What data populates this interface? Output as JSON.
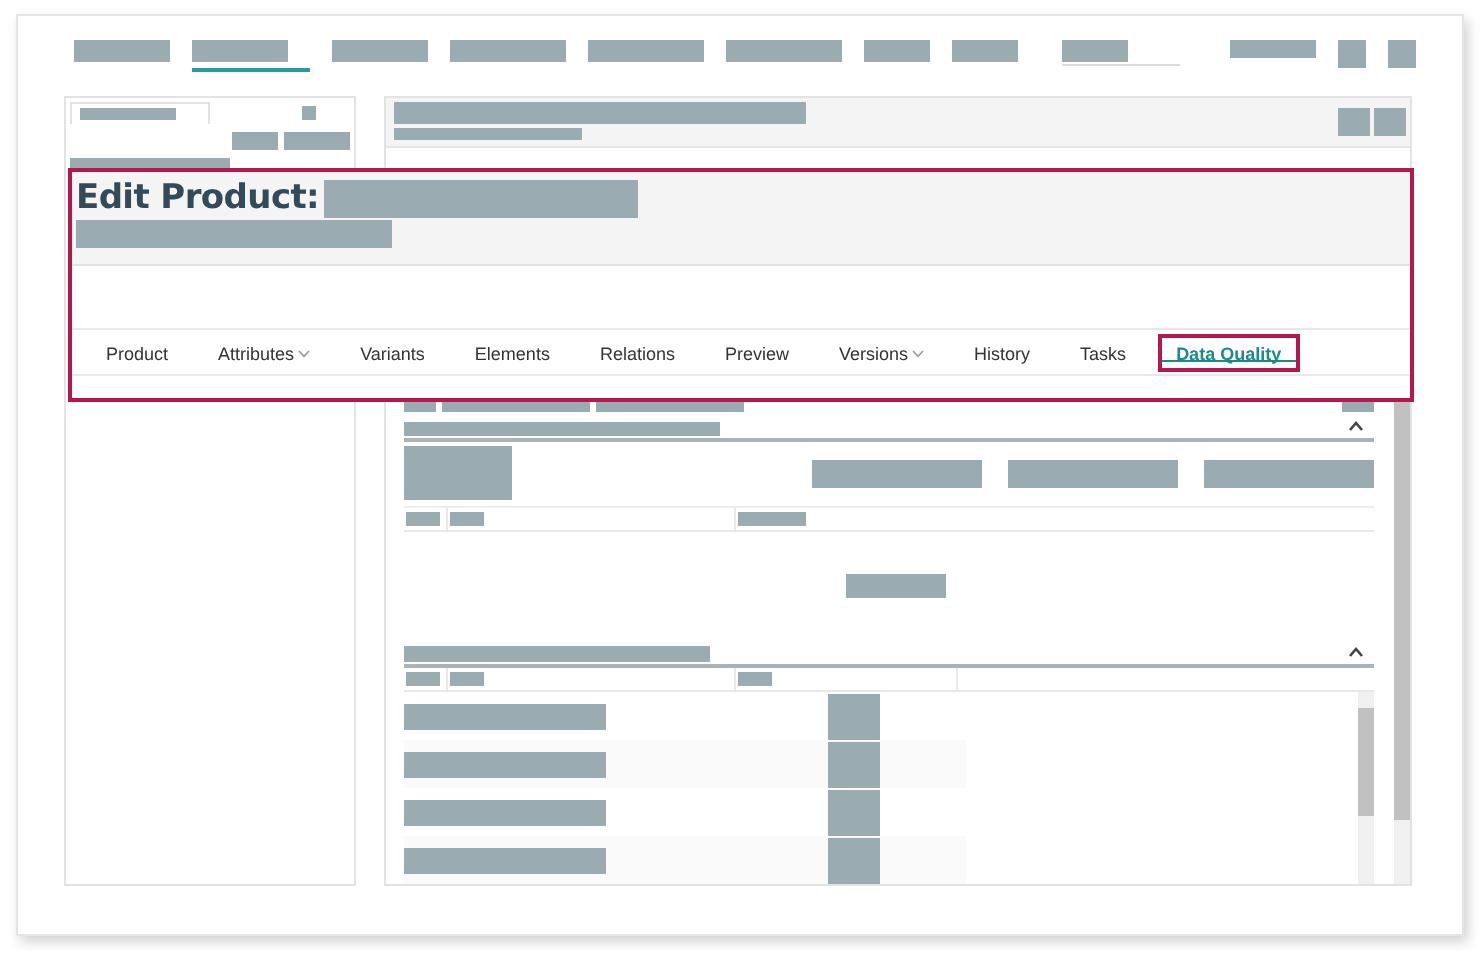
{
  "header": {
    "title": "Edit Product:"
  },
  "tabs": [
    {
      "label": "Product",
      "selected": false,
      "has_menu": false
    },
    {
      "label": "Attributes",
      "selected": false,
      "has_menu": true
    },
    {
      "label": "Variants",
      "selected": false,
      "has_menu": false
    },
    {
      "label": "Elements",
      "selected": false,
      "has_menu": false
    },
    {
      "label": "Relations",
      "selected": false,
      "has_menu": false
    },
    {
      "label": "Preview",
      "selected": false,
      "has_menu": false
    },
    {
      "label": "Versions",
      "selected": false,
      "has_menu": true
    },
    {
      "label": "History",
      "selected": false,
      "has_menu": false
    },
    {
      "label": "Tasks",
      "selected": false,
      "has_menu": false
    },
    {
      "label": "Data Quality",
      "selected": true,
      "has_menu": false
    }
  ]
}
